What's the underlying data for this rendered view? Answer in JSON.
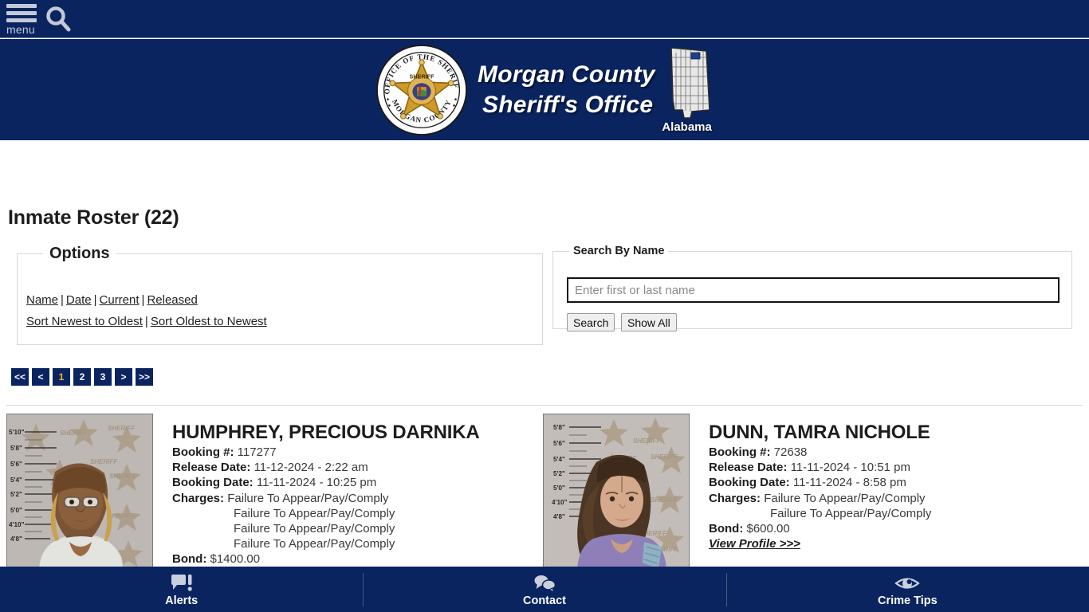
{
  "topbar": {
    "menu_label": "menu",
    "menu_icon": "hamburger-menu-icon",
    "search_icon": "search-icon"
  },
  "brand": {
    "seal_icon": "sheriff-badge-seal-icon",
    "seal_text_top": "OFFICE OF THE SHERIFF",
    "seal_text_bottom": "MORGAN COUNTY",
    "seal_star_text": "SHERIFF",
    "line1": "Morgan County",
    "line2": "Sheriff's Office",
    "map_icon": "alabama-state-map-icon",
    "map_label": "Alabama"
  },
  "page": {
    "title": "Inmate Roster (22)"
  },
  "options": {
    "legend": "Options",
    "row1": [
      {
        "label": "Name"
      },
      {
        "label": "Date"
      },
      {
        "label": "Current"
      },
      {
        "label": "Released"
      }
    ],
    "row2": [
      {
        "label": "Sort Newest to Oldest"
      },
      {
        "label": "Sort Oldest to Newest"
      }
    ],
    "separator": "|"
  },
  "search": {
    "legend": "Search By Name",
    "placeholder": "Enter first or last name",
    "value": "",
    "search_label": "Search",
    "showall_label": "Show All"
  },
  "pagination": {
    "items": [
      {
        "label": "<<",
        "active": false
      },
      {
        "label": "<",
        "active": false
      },
      {
        "label": "1",
        "active": true
      },
      {
        "label": "2",
        "active": false
      },
      {
        "label": "3",
        "active": false
      },
      {
        "label": ">",
        "active": false
      },
      {
        "label": ">>",
        "active": false
      }
    ]
  },
  "labels": {
    "booking_num": "Booking #:",
    "release_date": "Release Date:",
    "booking_date": "Booking Date:",
    "charges": "Charges:",
    "bond": "Bond:",
    "view_profile": "View Profile >>>"
  },
  "records": [
    {
      "name": "HUMPHREY, PRECIOUS DARNIKA",
      "booking_num": "117277",
      "release_date": "11-12-2024 - 2:22 am",
      "booking_date": "11-11-2024 - 10:25 pm",
      "charges": [
        "Failure To Appear/Pay/Comply",
        "Failure To Appear/Pay/Comply",
        "Failure To Appear/Pay/Comply",
        "Failure To Appear/Pay/Comply"
      ],
      "bond": "$1400.00",
      "mugshot_icon": "mugshot-photo",
      "mugshot_height_marks": [
        "5'10\"",
        "5'8\"",
        "5'6\"",
        "5'4\"",
        "5'2\"",
        "5'0\"",
        "4'10\"",
        "4'8\""
      ],
      "mugshot_backdrop_text": "SHERIFF"
    },
    {
      "name": "DUNN, TAMRA NICHOLE",
      "booking_num": "72638",
      "release_date": "11-11-2024 - 10:51 pm",
      "booking_date": "11-11-2024 - 8:58 pm",
      "charges": [
        "Failure To Appear/Pay/Comply",
        "Failure To Appear/Pay/Comply"
      ],
      "bond": "$600.00",
      "mugshot_icon": "mugshot-photo",
      "mugshot_height_marks": [
        "5'8\"",
        "5'6\"",
        "5'4\"",
        "5'2\"",
        "5'0\"",
        "4'10\"",
        "4'8\""
      ],
      "mugshot_backdrop_text": "SHERIFF"
    }
  ],
  "footer": {
    "items": [
      {
        "label": "Alerts",
        "icon": "speech-bubble-alert-icon"
      },
      {
        "label": "Contact",
        "icon": "chat-bubbles-icon"
      },
      {
        "label": "Crime Tips",
        "icon": "eye-icon"
      }
    ]
  },
  "colors": {
    "navy": "#0a2460",
    "accent_gold": "#f0b323",
    "text": "#1d1d1d"
  }
}
